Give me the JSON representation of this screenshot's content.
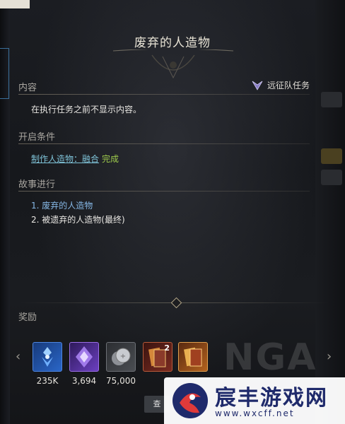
{
  "title": "废弃的人造物",
  "content": {
    "label": "内容",
    "type_tag": "远征队任务",
    "text": "在执行任务之前不显示内容。"
  },
  "conditions": {
    "label": "开启条件",
    "link_text": "制作人造物：融合",
    "status": "完成",
    "status_color": "#9ecb4c"
  },
  "story": {
    "label": "故事进行",
    "items": [
      "1. 废弃的人造物",
      "2. 被遗弃的人造物(最终)"
    ]
  },
  "rewards": {
    "label": "奖励",
    "items": [
      {
        "icon": "blue-crystal-icon",
        "qty": "235K",
        "color": "#2a66c8"
      },
      {
        "icon": "purple-crystal-icon",
        "qty": "3,694",
        "color": "#6b3fc0"
      },
      {
        "icon": "silver-coin-icon",
        "qty": "75,000",
        "color": "#4a4d52"
      },
      {
        "icon": "card-pack-icon",
        "qty": "",
        "badge": "2",
        "color": "#7a2a20"
      },
      {
        "icon": "card-pack-gold-icon",
        "qty": "",
        "color": "#b3621e"
      }
    ]
  },
  "button_label": "查",
  "watermark": {
    "title": "宸丰游戏网",
    "url": "www.wxcff.net",
    "bg_text": "NGA"
  }
}
